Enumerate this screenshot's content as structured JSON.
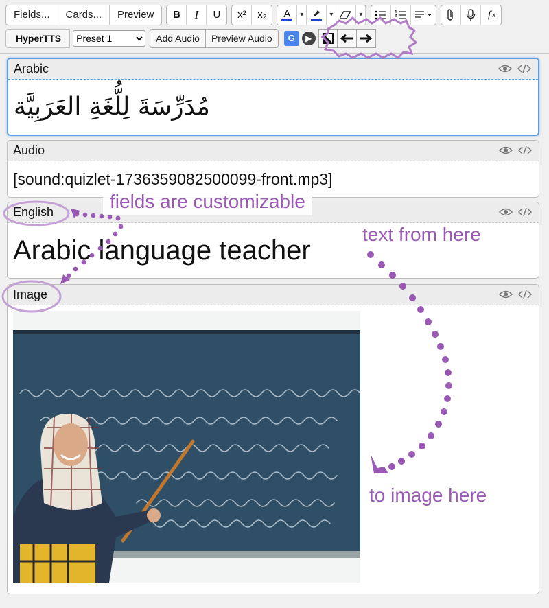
{
  "toolbar": {
    "fields_label": "Fields...",
    "cards_label": "Cards...",
    "preview_label": "Preview",
    "format_buttons": {
      "bold": "B",
      "italic": "I",
      "underline": "U",
      "superscript": "x²",
      "subscript": "x₂",
      "text_color": "A"
    }
  },
  "hypertts": {
    "label": "HyperTTS",
    "preset_value": "Preset 1",
    "add_audio_label": "Add Audio",
    "preview_audio_label": "Preview Audio"
  },
  "fields": {
    "arabic": {
      "name": "Arabic",
      "value": "مُدَرِّسَةَ لِلُّغَةِ العَرَبِيَّة"
    },
    "audio": {
      "name": "Audio",
      "value": "[sound:quizlet-1736359082500099-front.mp3]"
    },
    "english": {
      "name": "English",
      "value": "Arabic language teacher"
    },
    "image": {
      "name": "Image"
    }
  },
  "annotations": {
    "fields_customizable": "fields are customizable",
    "text_from_here": "text from here",
    "to_image_here": "to image here"
  },
  "colors": {
    "accent_purple": "#9b59b6",
    "focus_blue": "#5b9de0",
    "chalkboard": "#2f4f66"
  }
}
